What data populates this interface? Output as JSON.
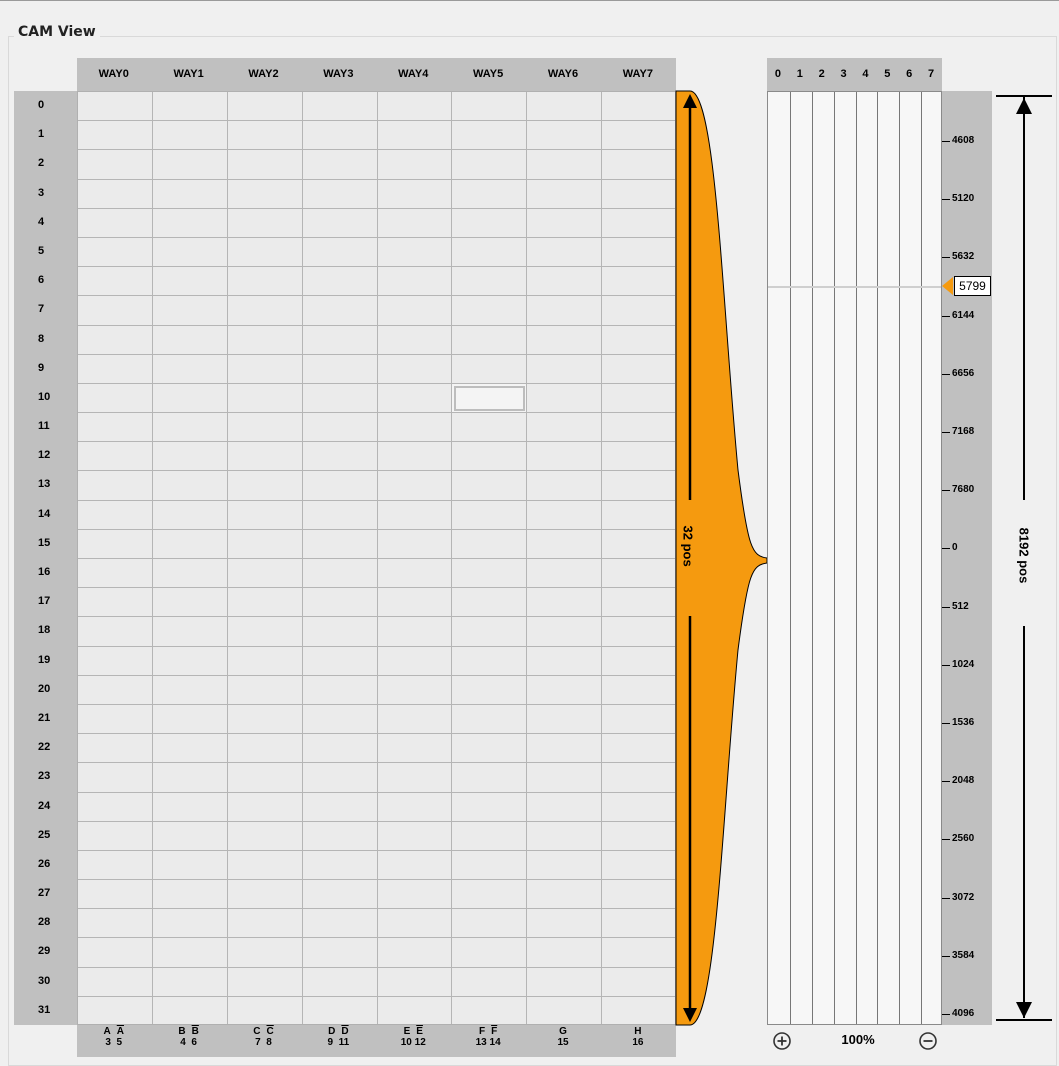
{
  "group_title": "CAM View",
  "ways": [
    "WAY0",
    "WAY1",
    "WAY2",
    "WAY3",
    "WAY4",
    "WAY5",
    "WAY6",
    "WAY7"
  ],
  "rows": [
    "0",
    "1",
    "2",
    "3",
    "4",
    "5",
    "6",
    "7",
    "8",
    "9",
    "10",
    "11",
    "12",
    "13",
    "14",
    "15",
    "16",
    "17",
    "18",
    "19",
    "20",
    "21",
    "22",
    "23",
    "24",
    "25",
    "26",
    "27",
    "28",
    "29",
    "30",
    "31"
  ],
  "column_keys": [
    {
      "letters": [
        "A",
        "A"
      ],
      "numbers": "3  5"
    },
    {
      "letters": [
        "B",
        "B"
      ],
      "numbers": "4  6"
    },
    {
      "letters": [
        "C",
        "C"
      ],
      "numbers": "7  8"
    },
    {
      "letters": [
        "D",
        "D"
      ],
      "numbers": "9  11"
    },
    {
      "letters": [
        "E",
        "E"
      ],
      "numbers": "10 12"
    },
    {
      "letters": [
        "F",
        "F"
      ],
      "numbers": "13 14"
    },
    {
      "letters": [
        "G"
      ],
      "numbers": "15"
    },
    {
      "letters": [
        "H"
      ],
      "numbers": "16"
    }
  ],
  "selected_cell": {
    "row": 10,
    "way": 5
  },
  "span_label": "32 pos",
  "map_columns": [
    "0",
    "1",
    "2",
    "3",
    "4",
    "5",
    "6",
    "7"
  ],
  "address_ticks": [
    "4608",
    "5120",
    "5632",
    "6144",
    "6656",
    "7168",
    "7680",
    "0",
    "512",
    "1024",
    "1536",
    "2048",
    "2560",
    "3072",
    "3584",
    "4096"
  ],
  "cursor_value": "5799",
  "total_label": "8192 pos",
  "zoom": {
    "level": "100%",
    "in_icon": "zoom-in-icon",
    "out_icon": "zoom-out-icon"
  },
  "colors": {
    "accent": "#f59a0f",
    "header": "#c0c0c0",
    "grid": "#ebebeb"
  }
}
